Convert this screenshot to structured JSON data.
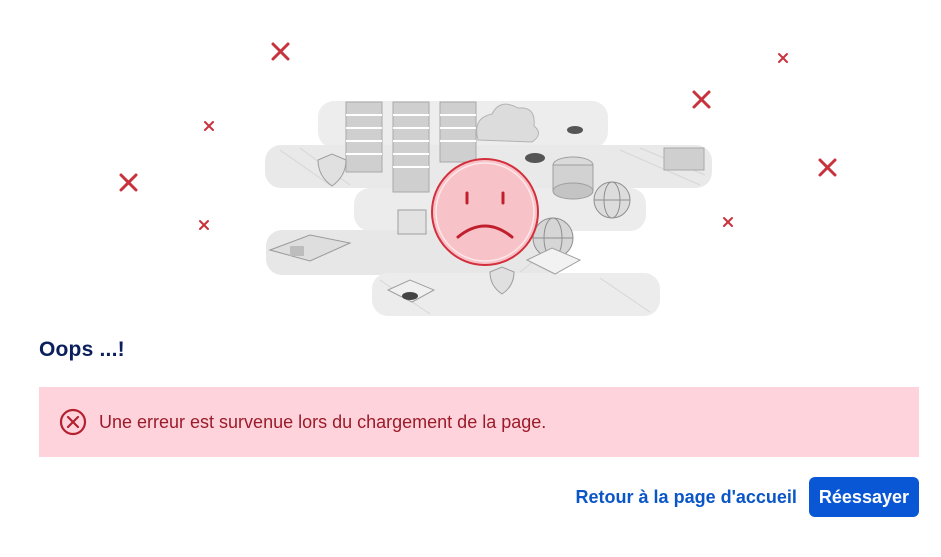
{
  "illustration": {
    "icon": "sad-face-city-illustration",
    "colors": {
      "cross": "#c8323c",
      "face_fill": "#f8c3c8",
      "face_stroke": "#d32f3c",
      "city": "#d9d9d9"
    }
  },
  "main": {
    "title": "Oops ...!",
    "error": {
      "icon": "error-circle-x-icon",
      "message": "Une erreur est survenue lors du chargement de la page.",
      "background": "#ffd3dc",
      "text_color": "#9b1b2a"
    },
    "actions": {
      "home_link_label": "Retour à la page d'accueil",
      "retry_label": "Réessayer",
      "accent": "#0a57d6"
    }
  }
}
